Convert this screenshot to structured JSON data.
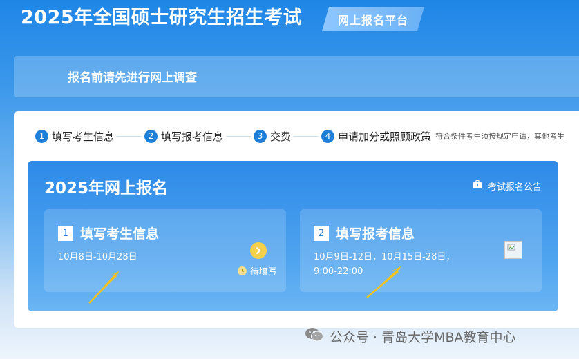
{
  "header": {
    "title": "2025年全国硕士研究生招生考试",
    "platform_badge": "网上报名平台"
  },
  "survey": {
    "text": "报名前请先进行网上调查"
  },
  "steps": [
    {
      "num": "1",
      "label": "填写考生信息"
    },
    {
      "num": "2",
      "label": "填写报考信息"
    },
    {
      "num": "3",
      "label": "交费"
    },
    {
      "num": "4",
      "label": "申请加分或照顾政策"
    }
  ],
  "steps_note": "符合条件考生须按规定申请，其他考生",
  "registration": {
    "title": "2025年网上报名",
    "notice_link": "考试报名公告",
    "cards": [
      {
        "num": "1",
        "title": "填写考生信息",
        "date": "10月8日-10月28日",
        "status": "待填写"
      },
      {
        "num": "2",
        "title": "填写报考信息",
        "date_line1": "10月9日-12日，10月15日-28日，",
        "date_line2": "9:00-22:00"
      }
    ]
  },
  "watermark": {
    "text": "公众号 · 青岛大学MBA教育中心"
  },
  "colors": {
    "primary": "#1d7fd8",
    "card_blue": "#2d8ae8",
    "arrow_yellow": "#f4c21d",
    "go_button": "#f4d04d"
  }
}
